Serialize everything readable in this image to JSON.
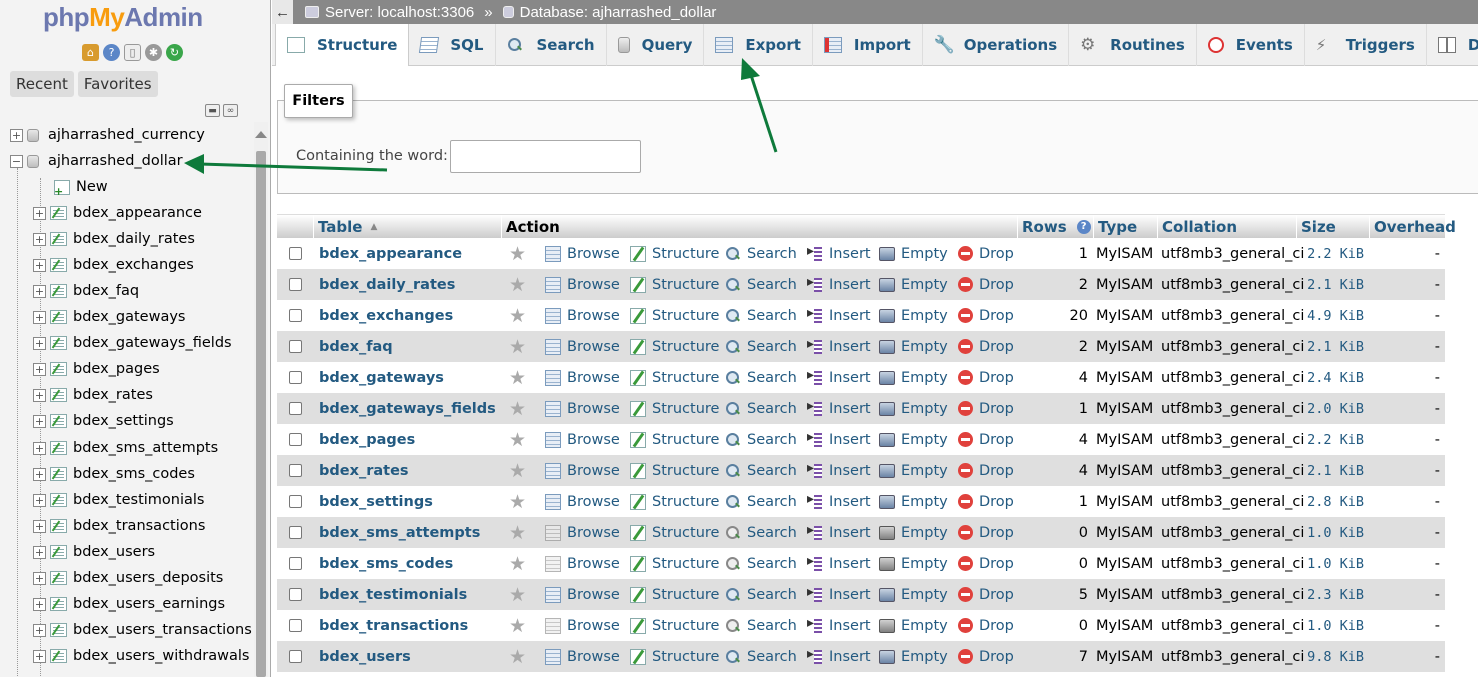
{
  "nav": {
    "logo_php": "php",
    "logo_my": "My",
    "logo_admin": "Admin",
    "recent_label": "Recent",
    "favorites_label": "Favorites",
    "databases": [
      {
        "name": "ajharrashed_currency",
        "expanded": false
      },
      {
        "name": "ajharrashed_dollar",
        "expanded": true
      }
    ],
    "new_label": "New",
    "tables": [
      "bdex_appearance",
      "bdex_daily_rates",
      "bdex_exchanges",
      "bdex_faq",
      "bdex_gateways",
      "bdex_gateways_fields",
      "bdex_pages",
      "bdex_rates",
      "bdex_settings",
      "bdex_sms_attempts",
      "bdex_sms_codes",
      "bdex_testimonials",
      "bdex_transactions",
      "bdex_users",
      "bdex_users_deposits",
      "bdex_users_earnings",
      "bdex_users_transactions",
      "bdex_users_withdrawals"
    ]
  },
  "breadcrumb": {
    "server": "Server: localhost:3306",
    "separator": "»",
    "database": "Database: ajharrashed_dollar"
  },
  "tabs": [
    {
      "label": "Structure",
      "icon": "structure-icon",
      "active": true
    },
    {
      "label": "SQL",
      "icon": "sql-icon"
    },
    {
      "label": "Search",
      "icon": "search-icon"
    },
    {
      "label": "Query",
      "icon": "query-icon"
    },
    {
      "label": "Export",
      "icon": "export-icon"
    },
    {
      "label": "Import",
      "icon": "import-icon"
    },
    {
      "label": "Operations",
      "icon": "wrench-icon"
    },
    {
      "label": "Routines",
      "icon": "routines-icon"
    },
    {
      "label": "Events",
      "icon": "clock-icon"
    },
    {
      "label": "Triggers",
      "icon": "triggers-icon"
    },
    {
      "label": "Designer",
      "icon": "designer-icon"
    }
  ],
  "filters": {
    "legend": "Filters",
    "label": "Containing the word:",
    "value": ""
  },
  "table": {
    "headers": {
      "table": "Table",
      "sort_arrow": "▲",
      "action": "Action",
      "rows": "Rows",
      "type": "Type",
      "collation": "Collation",
      "size": "Size",
      "overhead": "Overhead"
    },
    "actions": {
      "browse": "Browse",
      "structure": "Structure",
      "search": "Search",
      "insert": "Insert",
      "empty": "Empty",
      "drop": "Drop"
    },
    "rows": [
      {
        "name": "bdex_appearance",
        "rows": "1",
        "type": "MyISAM",
        "collation": "utf8mb3_general_ci",
        "size": "2.2 KiB",
        "overhead": "-"
      },
      {
        "name": "bdex_daily_rates",
        "rows": "2",
        "type": "MyISAM",
        "collation": "utf8mb3_general_ci",
        "size": "2.1 KiB",
        "overhead": "-"
      },
      {
        "name": "bdex_exchanges",
        "rows": "20",
        "type": "MyISAM",
        "collation": "utf8mb3_general_ci",
        "size": "4.9 KiB",
        "overhead": "-"
      },
      {
        "name": "bdex_faq",
        "rows": "2",
        "type": "MyISAM",
        "collation": "utf8mb3_general_ci",
        "size": "2.1 KiB",
        "overhead": "-"
      },
      {
        "name": "bdex_gateways",
        "rows": "4",
        "type": "MyISAM",
        "collation": "utf8mb3_general_ci",
        "size": "2.4 KiB",
        "overhead": "-"
      },
      {
        "name": "bdex_gateways_fields",
        "rows": "1",
        "type": "MyISAM",
        "collation": "utf8mb3_general_ci",
        "size": "2.0 KiB",
        "overhead": "-"
      },
      {
        "name": "bdex_pages",
        "rows": "4",
        "type": "MyISAM",
        "collation": "utf8mb3_general_ci",
        "size": "2.2 KiB",
        "overhead": "-"
      },
      {
        "name": "bdex_rates",
        "rows": "4",
        "type": "MyISAM",
        "collation": "utf8mb3_general_ci",
        "size": "2.1 KiB",
        "overhead": "-"
      },
      {
        "name": "bdex_settings",
        "rows": "1",
        "type": "MyISAM",
        "collation": "utf8mb3_general_ci",
        "size": "2.8 KiB",
        "overhead": "-"
      },
      {
        "name": "bdex_sms_attempts",
        "rows": "0",
        "type": "MyISAM",
        "collation": "utf8mb3_general_ci",
        "size": "1.0 KiB",
        "overhead": "-"
      },
      {
        "name": "bdex_sms_codes",
        "rows": "0",
        "type": "MyISAM",
        "collation": "utf8mb3_general_ci",
        "size": "1.0 KiB",
        "overhead": "-"
      },
      {
        "name": "bdex_testimonials",
        "rows": "5",
        "type": "MyISAM",
        "collation": "utf8mb3_general_ci",
        "size": "2.3 KiB",
        "overhead": "-"
      },
      {
        "name": "bdex_transactions",
        "rows": "0",
        "type": "MyISAM",
        "collation": "utf8mb3_general_ci",
        "size": "1.0 KiB",
        "overhead": "-"
      },
      {
        "name": "bdex_users",
        "rows": "7",
        "type": "MyISAM",
        "collation": "utf8mb3_general_ci",
        "size": "9.8 KiB",
        "overhead": "-"
      }
    ]
  },
  "colors": {
    "link": "#235a81",
    "annotation_arrow": "#0e7a3b",
    "drop_icon": "#e0413c"
  }
}
